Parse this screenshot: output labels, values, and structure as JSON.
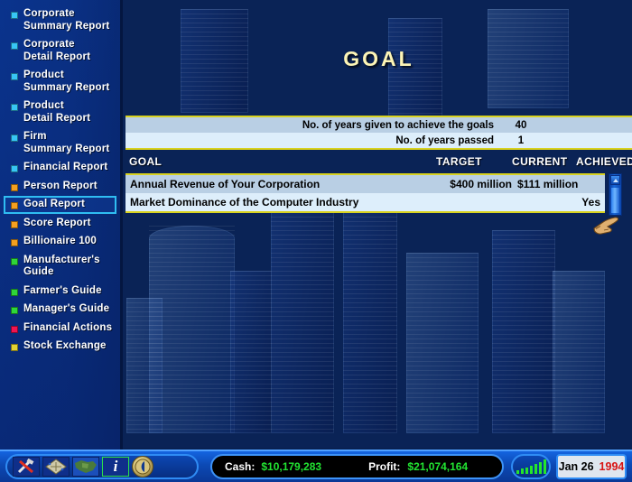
{
  "sidebar": {
    "items": [
      {
        "label": "Corporate\nSummary Report",
        "bullet": "#37c6f5",
        "selected": false,
        "icon": "square-bullet-icon"
      },
      {
        "label": "Corporate\nDetail Report",
        "bullet": "#37c6f5",
        "selected": false,
        "icon": "square-bullet-icon"
      },
      {
        "label": "Product\nSummary Report",
        "bullet": "#37c6f5",
        "selected": false,
        "icon": "square-bullet-icon"
      },
      {
        "label": "Product\nDetail Report",
        "bullet": "#37c6f5",
        "selected": false,
        "icon": "square-bullet-icon"
      },
      {
        "label": "Firm\nSummary Report",
        "bullet": "#37c6f5",
        "selected": false,
        "icon": "square-bullet-icon"
      },
      {
        "label": "Financial Report",
        "bullet": "#37c6f5",
        "selected": false,
        "icon": "square-bullet-icon"
      },
      {
        "label": "Person Report",
        "bullet": "#f5a020",
        "selected": false,
        "icon": "square-bullet-icon"
      },
      {
        "label": "Goal Report",
        "bullet": "#f5a020",
        "selected": true,
        "icon": "square-bullet-icon"
      },
      {
        "label": "Score Report",
        "bullet": "#f5a020",
        "selected": false,
        "icon": "square-bullet-icon"
      },
      {
        "label": "Billionaire 100",
        "bullet": "#f5a020",
        "selected": false,
        "icon": "square-bullet-icon"
      },
      {
        "label": "Manufacturer's\nGuide",
        "bullet": "#2fd63a",
        "selected": false,
        "icon": "square-bullet-icon"
      },
      {
        "label": "Farmer's Guide",
        "bullet": "#2fd63a",
        "selected": false,
        "icon": "square-bullet-icon"
      },
      {
        "label": "Manager's Guide",
        "bullet": "#2fd63a",
        "selected": false,
        "icon": "square-bullet-icon"
      },
      {
        "label": "Financial Actions",
        "bullet": "#ef1452",
        "selected": false,
        "icon": "square-bullet-icon"
      },
      {
        "label": "Stock Exchange",
        "bullet": "#e3d233",
        "selected": false,
        "icon": "square-bullet-icon"
      }
    ]
  },
  "main": {
    "title": "GOAL",
    "title_color": "#fdf5b6",
    "info_rows": [
      {
        "label": "No. of years given to achieve the goals",
        "value": "40"
      },
      {
        "label": "No. of years passed",
        "value": "1"
      }
    ],
    "table": {
      "headers": {
        "goal": "GOAL",
        "target": "TARGET",
        "current": "CURRENT",
        "achieved": "ACHIEVED"
      },
      "rows": [
        {
          "goal": "Annual Revenue of Your Corporation",
          "target": "$400 million",
          "current": "$111 million",
          "achieved": ""
        },
        {
          "goal": "Market Dominance of the Computer Industry",
          "target": "",
          "current": "",
          "achieved": "Yes"
        }
      ]
    }
  },
  "bottombar": {
    "tools": [
      {
        "name": "tools-icon",
        "glyph": "⚒"
      },
      {
        "name": "city-map-icon",
        "glyph": "◈"
      },
      {
        "name": "world-map-icon",
        "glyph": "▣"
      },
      {
        "name": "info-icon",
        "glyph": "i"
      },
      {
        "name": "back-arrow-icon",
        "glyph": "◀"
      }
    ],
    "cash_label": "Cash:",
    "cash_value": "$10,179,283",
    "profit_label": "Profit:",
    "profit_value": "$21,074,164",
    "money_color": "#22e432",
    "graph_icon": "bar-chart-icon",
    "date_monthday": "Jan 26",
    "date_year": "1994",
    "date_year_color": "#d81414"
  }
}
